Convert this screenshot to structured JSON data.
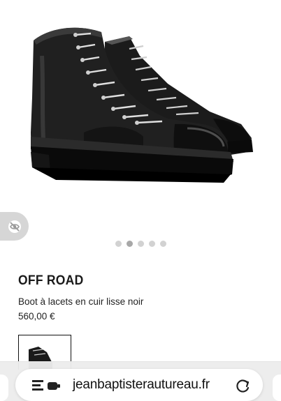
{
  "product": {
    "name": "OFF ROAD",
    "description": "Boot à lacets en cuir lisse noir",
    "price": "560,00 €"
  },
  "gallery": {
    "image_count": 5,
    "active_index": 1
  },
  "browser": {
    "url": "jeanbaptisterautureau.fr"
  },
  "icons": {
    "side_widget": "eye-slash-icon",
    "reader": "reader-mode-icon",
    "reload": "reload-icon"
  }
}
